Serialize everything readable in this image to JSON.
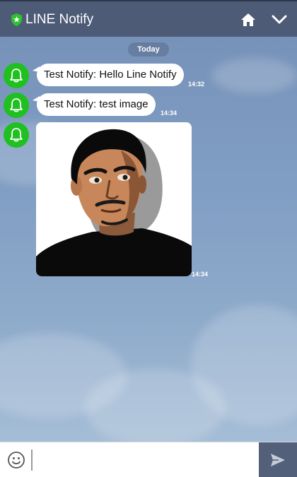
{
  "header": {
    "title": "LINE Notify",
    "icons": {
      "shield": "shield-star-icon",
      "home": "home-icon",
      "menu": "chevron-down-icon"
    }
  },
  "chat": {
    "date_label": "Today",
    "messages": [
      {
        "sender_icon": "bell-icon",
        "text": "Test Notify: Hello Line Notify",
        "time": "14:32"
      },
      {
        "sender_icon": "bell-icon",
        "text": "Test Notify: test image",
        "time": "14:34"
      },
      {
        "sender_icon": "bell-icon",
        "type": "image",
        "time": "14:34"
      }
    ]
  },
  "composer": {
    "value": "",
    "placeholder": "",
    "icons": {
      "emoji": "smiley-icon",
      "send": "send-icon"
    }
  },
  "colors": {
    "header_bg": "#4e5b77",
    "chat_bg": "#7f9ec2",
    "avatar_green": "#1fc01f",
    "send_bg": "#53607a"
  }
}
